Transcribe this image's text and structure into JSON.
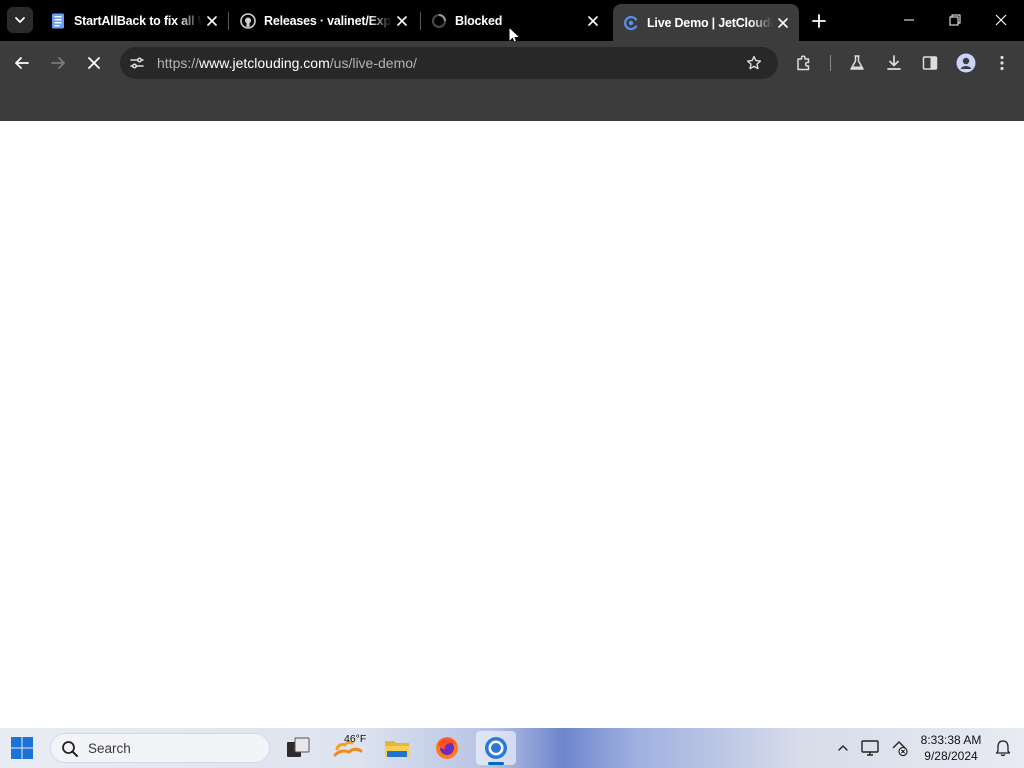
{
  "browser": {
    "tabs": [
      {
        "title": "StartAllBack to fix all Windows",
        "favicon": "document-icon",
        "active": false
      },
      {
        "title": "Releases · valinet/ExplorerPatcher",
        "favicon": "github-icon",
        "active": false
      },
      {
        "title": "Blocked",
        "favicon": "loading-icon",
        "active": false
      },
      {
        "title": "Live Demo | JetClouding",
        "favicon": "jetclouding-icon",
        "active": true
      }
    ],
    "address_bar": {
      "scheme": "https://",
      "host": "www.jetclouding.com",
      "path": "/us/live-demo/"
    },
    "loading": true
  },
  "taskbar": {
    "search_placeholder": "Search",
    "weather_temp": "46°F",
    "clock_time": "8:33:38 AM",
    "clock_date": "9/28/2024"
  },
  "colors": {
    "tabstrip": "#000000",
    "toolbar": "#3c3c3c",
    "omnibox": "#282828",
    "page": "#ffffff",
    "accent": "#0067c0"
  }
}
